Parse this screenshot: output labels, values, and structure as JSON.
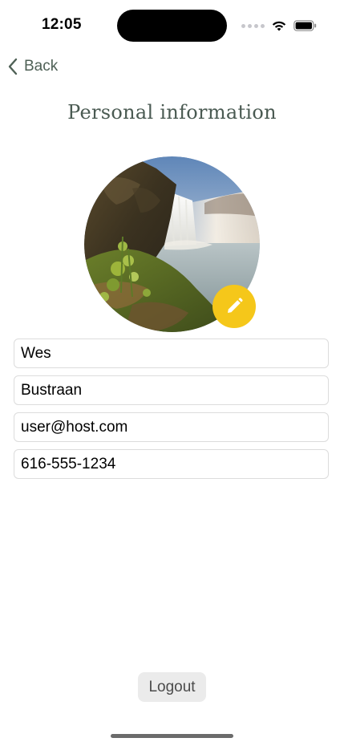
{
  "status_bar": {
    "time": "12:05",
    "icons": [
      "cellular-signal-icon",
      "wifi-icon",
      "battery-icon"
    ]
  },
  "nav": {
    "back_label": "Back",
    "back_icon": "chevron-left-icon"
  },
  "page": {
    "title": "Personal information"
  },
  "profile": {
    "avatar": "waterfall-landscape-photo",
    "edit_icon": "pencil-icon"
  },
  "form": {
    "first_name": "Wes",
    "last_name": "Bustraan",
    "email": "user@host.com",
    "phone": "616-555-1234"
  },
  "actions": {
    "logout_label": "Logout"
  },
  "colors": {
    "accent_yellow": "#f5c71a",
    "title_green": "#4a5a52",
    "back_green": "#4f6156",
    "field_border": "#dcdcdc",
    "logout_bg": "#ebebeb"
  }
}
